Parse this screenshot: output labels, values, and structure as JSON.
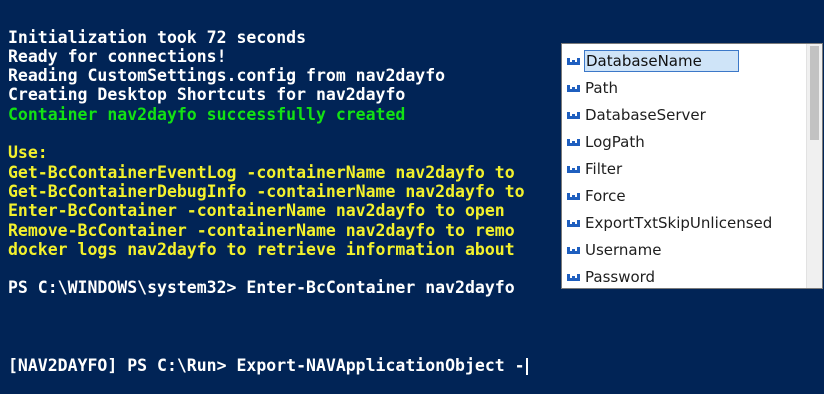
{
  "console": {
    "lines": [
      {
        "text": "Initialization took 72 seconds",
        "color": "white"
      },
      {
        "text": "Ready for connections!",
        "color": "white"
      },
      {
        "text": "Reading CustomSettings.config from nav2dayfo",
        "color": "white"
      },
      {
        "text": "Creating Desktop Shortcuts for nav2dayfo",
        "color": "white"
      },
      {
        "text": "Container nav2dayfo successfully created",
        "color": "green"
      },
      {
        "text": "",
        "color": "white"
      },
      {
        "text": "Use:",
        "color": "yellow"
      },
      {
        "text": "Get-BcContainerEventLog -containerName nav2dayfo to",
        "color": "yellow"
      },
      {
        "text": "Get-BcContainerDebugInfo -containerName nav2dayfo to",
        "color": "yellow"
      },
      {
        "text": "Enter-BcContainer -containerName nav2dayfo to open",
        "color": "yellow"
      },
      {
        "text": "Remove-BcContainer -containerName nav2dayfo to remo",
        "color": "yellow"
      },
      {
        "text": "docker logs nav2dayfo to retrieve information about",
        "color": "yellow"
      },
      {
        "text": "",
        "color": "white"
      },
      {
        "text": "PS C:\\WINDOWS\\system32> Enter-BcContainer nav2dayfo",
        "color": "white"
      },
      {
        "text": "",
        "color": "white"
      }
    ],
    "prompt": "[NAV2DAYFO] PS C:\\Run> Export-NAVApplicationObject ",
    "typed": "-"
  },
  "completion": {
    "selected_index": 0,
    "items": [
      {
        "label": "DatabaseName",
        "icon": "parameter-icon"
      },
      {
        "label": "Path",
        "icon": "parameter-icon"
      },
      {
        "label": "DatabaseServer",
        "icon": "parameter-icon"
      },
      {
        "label": "LogPath",
        "icon": "parameter-icon"
      },
      {
        "label": "Filter",
        "icon": "parameter-icon"
      },
      {
        "label": "Force",
        "icon": "parameter-icon"
      },
      {
        "label": "ExportTxtSkipUnlicensed",
        "icon": "parameter-icon"
      },
      {
        "label": "Username",
        "icon": "parameter-icon"
      },
      {
        "label": "Password",
        "icon": "parameter-icon"
      }
    ]
  },
  "colors": {
    "background": "#012456",
    "white": "#ffffff",
    "green": "#13e213",
    "yellow": "#f3f12c",
    "selection": "#cfe4f8",
    "selection_border": "#3c78c8",
    "icon_blue": "#1f5fbf"
  }
}
